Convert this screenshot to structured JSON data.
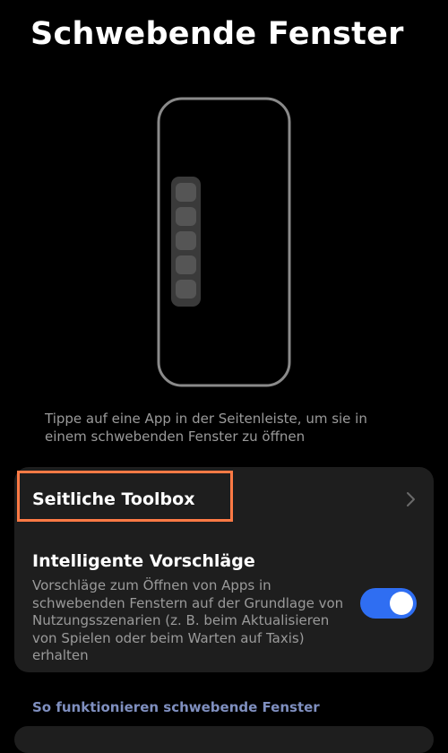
{
  "page": {
    "title": "Schwebende Fenster",
    "caption": "Tippe auf eine App in der Seitenleiste, um sie in einem schwebenden Fenster zu öffnen"
  },
  "illustration": {
    "icon": "phone-with-sidebar-icon",
    "sidebar_app_slots": 5
  },
  "settings": {
    "toolbox": {
      "label": "Seitliche Toolbox",
      "chevron_icon": "chevron-right-icon"
    },
    "suggestions": {
      "title": "Intelligente Vorschläge",
      "description": "Vorschläge zum Öffnen von Apps in schwebenden Fenstern auf der Grundlage von Nutzungsszenarien (z. B. beim Aktualisieren von Spielen oder beim Warten auf Taxis) erhalten",
      "enabled": true
    }
  },
  "section": {
    "header": "So funktionieren schwebende Fenster"
  },
  "colors": {
    "background": "#000000",
    "card": "#1e1e1e",
    "accent": "#2f6ef2",
    "highlight": "#ff7a45",
    "secondary_text": "#9a9a9a",
    "section_header": "#7f8fbf"
  }
}
